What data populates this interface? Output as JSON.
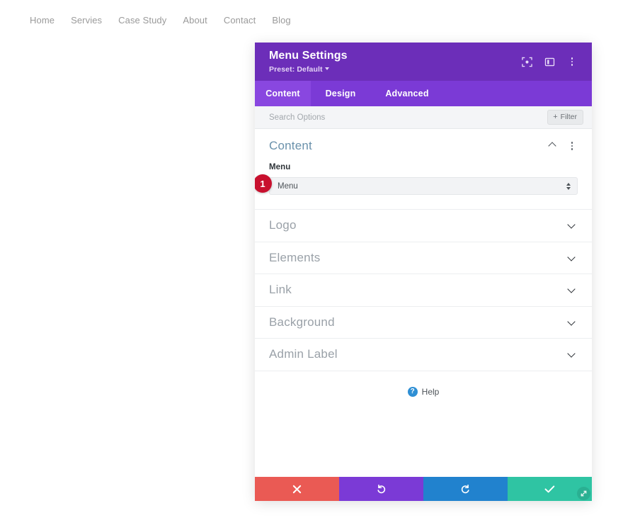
{
  "site_nav": {
    "items": [
      {
        "label": "Home"
      },
      {
        "label": "Servies"
      },
      {
        "label": "Case Study"
      },
      {
        "label": "About"
      },
      {
        "label": "Contact"
      },
      {
        "label": "Blog"
      }
    ]
  },
  "modal": {
    "title": "Menu Settings",
    "preset_label": "Preset: Default",
    "header_icons": [
      {
        "name": "focus-target-icon"
      },
      {
        "name": "split-layout-icon"
      },
      {
        "name": "more-options-icon"
      }
    ],
    "tabs": [
      {
        "label": "Content",
        "active": true
      },
      {
        "label": "Design",
        "active": false
      },
      {
        "label": "Advanced",
        "active": false
      }
    ],
    "search": {
      "placeholder": "Search Options",
      "value": ""
    },
    "filter_button": {
      "label": "Filter",
      "plus": "+"
    },
    "content_section": {
      "title": "Content",
      "field_label": "Menu",
      "select_value": "Menu",
      "step_badge": "1"
    },
    "collapsed_sections": [
      {
        "title": "Logo"
      },
      {
        "title": "Elements"
      },
      {
        "title": "Link"
      },
      {
        "title": "Background"
      },
      {
        "title": "Admin Label"
      }
    ],
    "help": {
      "icon_glyph": "?",
      "label": "Help"
    },
    "footer_buttons": [
      {
        "name": "cancel-button",
        "icon": "close-icon",
        "color": "#ea5a54"
      },
      {
        "name": "undo-button",
        "icon": "undo-icon",
        "color": "#7b3ad6"
      },
      {
        "name": "redo-button",
        "icon": "redo-icon",
        "color": "#2182ce"
      },
      {
        "name": "save-button",
        "icon": "check-icon",
        "color": "#2fc4a3"
      }
    ]
  },
  "colors": {
    "header_purple": "#6c2eb9",
    "tabbar_purple": "#7b3ad6",
    "active_tab_purple": "#8947e0",
    "badge_red": "#c8102e",
    "help_blue": "#2e8fd4",
    "section_title_blue": "#6a91ab"
  }
}
